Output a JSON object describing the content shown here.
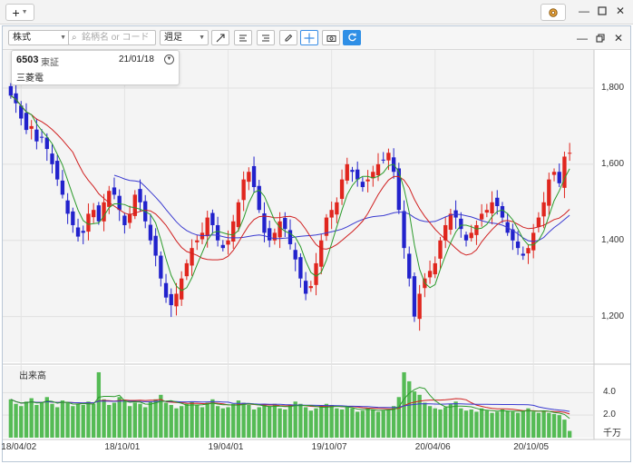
{
  "app": {
    "add_button_label": "+",
    "window_controls": [
      "minimize",
      "restore",
      "close"
    ]
  },
  "toolbar": {
    "type_select": "株式",
    "search_placeholder": "銘柄名 or コード",
    "period_select": "週足",
    "tools": [
      "trend-line-icon",
      "align-left-icon",
      "align-right-icon",
      "pencil-icon",
      "crosshair-icon",
      "camera-icon",
      "refresh-icon"
    ]
  },
  "info": {
    "code": "6503",
    "market": "東証",
    "date": "21/01/18",
    "name": "三菱電"
  },
  "volume_panel": {
    "title": "出来高",
    "unit": "千万"
  },
  "colors": {
    "up": "#e0261e",
    "down": "#2222cc",
    "ma_short": "#2a9a2a",
    "ma_mid": "#d02020",
    "ma_long": "#3a3ad0",
    "volume_bar": "#55bb55",
    "accent": "#2f8fe6"
  },
  "chart_data": [
    {
      "type": "candlestick",
      "interval": "weekly",
      "y_ticks": [
        "1,800",
        "1,600",
        "1,400",
        "1,200"
      ],
      "y_tick_values": [
        1800,
        1600,
        1400,
        1200
      ],
      "x_tick_labels": [
        "18/04/02",
        "18/10/01",
        "19/04/01",
        "19/10/07",
        "20/04/06",
        "20/10/05"
      ],
      "ylim": [
        1080,
        1900
      ],
      "series": [
        {
          "name": "close",
          "values": [
            1780,
            1760,
            1720,
            1690,
            1700,
            1660,
            1670,
            1640,
            1600,
            1560,
            1520,
            1470,
            1440,
            1410,
            1420,
            1470,
            1480,
            1450,
            1500,
            1530,
            1520,
            1480,
            1440,
            1470,
            1520,
            1500,
            1450,
            1400,
            1360,
            1300,
            1250,
            1230,
            1260,
            1300,
            1340,
            1380,
            1400,
            1420,
            1460,
            1440,
            1400,
            1380,
            1400,
            1450,
            1500,
            1560,
            1580,
            1540,
            1480,
            1420,
            1400,
            1420,
            1450,
            1430,
            1390,
            1350,
            1300,
            1260,
            1280,
            1340,
            1400,
            1460,
            1480,
            1500,
            1560,
            1600,
            1580,
            1560,
            1540,
            1560,
            1580,
            1600,
            1610,
            1630,
            1580,
            1480,
            1380,
            1300,
            1200,
            1260,
            1300,
            1320,
            1340,
            1400,
            1440,
            1470,
            1460,
            1430,
            1400,
            1420,
            1440,
            1470,
            1480,
            1500,
            1490,
            1460,
            1420,
            1400,
            1380,
            1360,
            1380,
            1420,
            1460,
            1500,
            1560,
            1580,
            1550,
            1620,
            1630
          ]
        }
      ],
      "ma_lines": [
        "short",
        "mid",
        "long"
      ]
    },
    {
      "type": "bar",
      "title": "出来高",
      "y_ticks": [
        "4.0",
        "2.0"
      ],
      "y_tick_values": [
        4.0,
        2.0
      ],
      "unit": "千万",
      "ylim": [
        0,
        6.2
      ],
      "values": [
        3.4,
        3.0,
        2.8,
        3.2,
        3.5,
        2.9,
        3.1,
        3.6,
        3.0,
        2.7,
        3.3,
        3.1,
        2.8,
        3.0,
        2.9,
        3.2,
        3.0,
        5.8,
        3.4,
        2.9,
        3.1,
        3.6,
        3.3,
        2.8,
        3.1,
        3.0,
        2.7,
        3.2,
        3.4,
        3.8,
        3.1,
        2.9,
        2.6,
        2.8,
        3.0,
        3.2,
        2.9,
        2.7,
        3.1,
        3.4,
        2.8,
        2.6,
        2.7,
        3.0,
        3.3,
        3.1,
        2.9,
        2.5,
        2.7,
        2.9,
        2.8,
        3.0,
        2.6,
        2.5,
        2.9,
        3.2,
        3.0,
        2.7,
        2.4,
        2.6,
        2.8,
        3.0,
        2.9,
        2.6,
        2.5,
        2.7,
        2.6,
        2.3,
        2.4,
        2.6,
        2.5,
        2.3,
        2.4,
        2.5,
        2.8,
        3.6,
        5.8,
        5.0,
        4.1,
        3.8,
        3.1,
        2.8,
        2.6,
        2.5,
        2.7,
        3.0,
        3.2,
        2.6,
        2.4,
        2.5,
        2.3,
        2.6,
        2.4,
        2.2,
        2.3,
        2.5,
        2.4,
        2.3,
        2.2,
        2.4,
        2.6,
        2.3,
        2.2,
        2.4,
        2.2,
        2.1,
        2.0,
        1.6,
        0.6
      ]
    }
  ]
}
